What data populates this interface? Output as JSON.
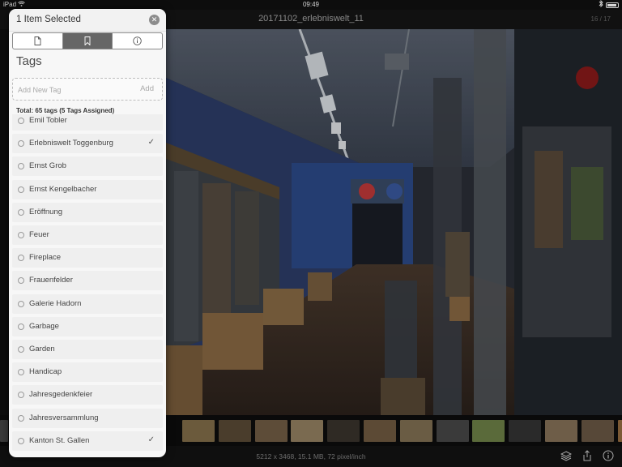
{
  "status_bar": {
    "device": "iPad",
    "time": "09:49",
    "wifi_icon": "wifi-icon",
    "bluetooth_icon": "bluetooth-icon"
  },
  "header": {
    "title": "20171102_erlebniswelt_11",
    "counter": "16 / 17"
  },
  "panel": {
    "title": "1 Item Selected",
    "close_icon": "close-icon",
    "tabs": [
      {
        "icon": "document-icon",
        "active": false
      },
      {
        "icon": "bookmark-icon",
        "active": true
      },
      {
        "icon": "info-icon",
        "active": false
      }
    ],
    "section_title": "Tags",
    "add_placeholder": "Add New Tag",
    "add_label": "Add",
    "total": "Total: 65 tags (5 Tags Assigned)",
    "tags": [
      {
        "name": "Emil Tobler",
        "checked": false
      },
      {
        "name": "Erlebniswelt Toggenburg",
        "checked": true
      },
      {
        "name": "Ernst Grob",
        "checked": false
      },
      {
        "name": "Ernst Kengelbacher",
        "checked": false
      },
      {
        "name": "Eröffnung",
        "checked": false
      },
      {
        "name": "Feuer",
        "checked": false
      },
      {
        "name": "Fireplace",
        "checked": false
      },
      {
        "name": "Frauenfelder",
        "checked": false
      },
      {
        "name": "Galerie Hadorn",
        "checked": false
      },
      {
        "name": "Garbage",
        "checked": false
      },
      {
        "name": "Garden",
        "checked": false
      },
      {
        "name": "Handicap",
        "checked": false
      },
      {
        "name": "Jahresgedenkfeier",
        "checked": false
      },
      {
        "name": "Jahresversammlung",
        "checked": false
      },
      {
        "name": "Kanton St. Gallen",
        "checked": true
      }
    ]
  },
  "bottom_bar": {
    "info": "5212 x 3468, 15.1 MB, 72 pixel/inch",
    "icons": [
      "layers-icon",
      "share-icon",
      "info-icon"
    ]
  },
  "thumbnails": [
    {
      "color": "#6b5a3c"
    },
    {
      "color": "#4a3d2c"
    },
    {
      "color": "#5d4c38"
    },
    {
      "color": "#7a6a50"
    },
    {
      "color": "#2f2a24"
    },
    {
      "color": "#5c4a35"
    },
    {
      "color": "#6a5c44"
    },
    {
      "color": "#3a3a3a"
    },
    {
      "color": "#5a6a3a"
    },
    {
      "color": "#2a2a2a"
    },
    {
      "color": "#6e5d48"
    },
    {
      "color": "#574838"
    },
    {
      "color": "#7c5a35"
    },
    {
      "color": "#8a8a90"
    }
  ],
  "colors": {
    "panel_bg": "#f7f7f7",
    "active_tab": "#666666",
    "photo_wall": "#2a3e72"
  }
}
